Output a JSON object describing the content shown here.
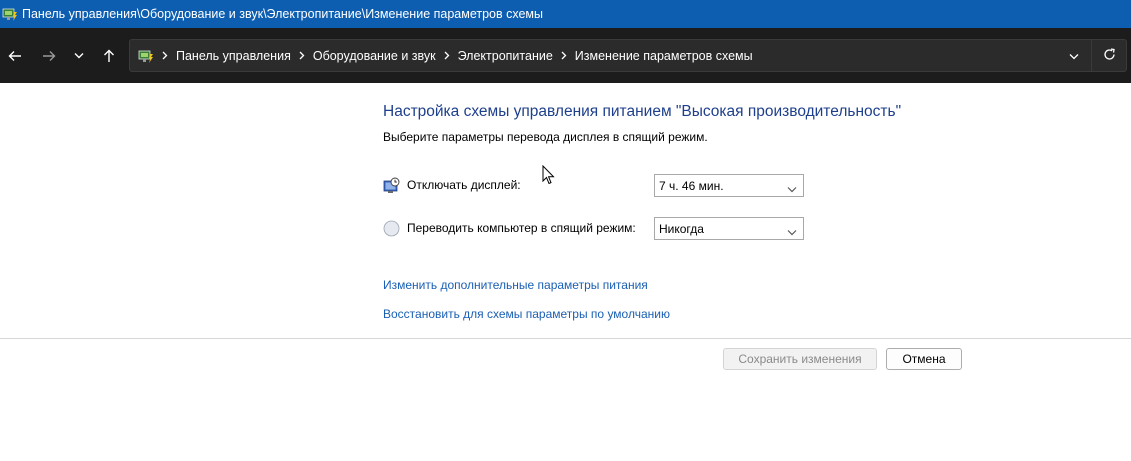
{
  "window": {
    "title": "Панель управления\\Оборудование и звук\\Электропитание\\Изменение параметров схемы",
    "title_color": "#0d5eb0"
  },
  "navigation": {
    "back_icon": "arrow-left-icon",
    "forward_icon": "arrow-right-icon",
    "recent_icon": "chevron-down-icon",
    "up_icon": "arrow-up-icon"
  },
  "address_bar": {
    "crumbs": [
      "Панель управления",
      "Оборудование и звук",
      "Электропитание",
      "Изменение параметров схемы"
    ],
    "dropdown_icon": "chevron-down-icon",
    "refresh_icon": "refresh-icon"
  },
  "content": {
    "title": "Настройка схемы управления питанием \"Высокая производительность\"",
    "subtitle": "Выберите параметры перевода дисплея в спящий режим.",
    "display_off": {
      "label": "Отключать дисплей:",
      "value": "7 ч. 46 мин.",
      "icon": "monitor-clock-icon"
    },
    "sleep": {
      "label": "Переводить компьютер в спящий режим:",
      "value": "Никогда",
      "icon": "moon-icon"
    },
    "links": {
      "advanced": "Изменить дополнительные параметры питания",
      "restore": "Восстановить для схемы параметры по умолчанию"
    }
  },
  "buttons": {
    "save": "Сохранить изменения",
    "cancel": "Отмена"
  },
  "colors": {
    "heading": "#1e3f8c",
    "link": "#1a5fb4",
    "navbar_bg": "#1c1c1c"
  }
}
